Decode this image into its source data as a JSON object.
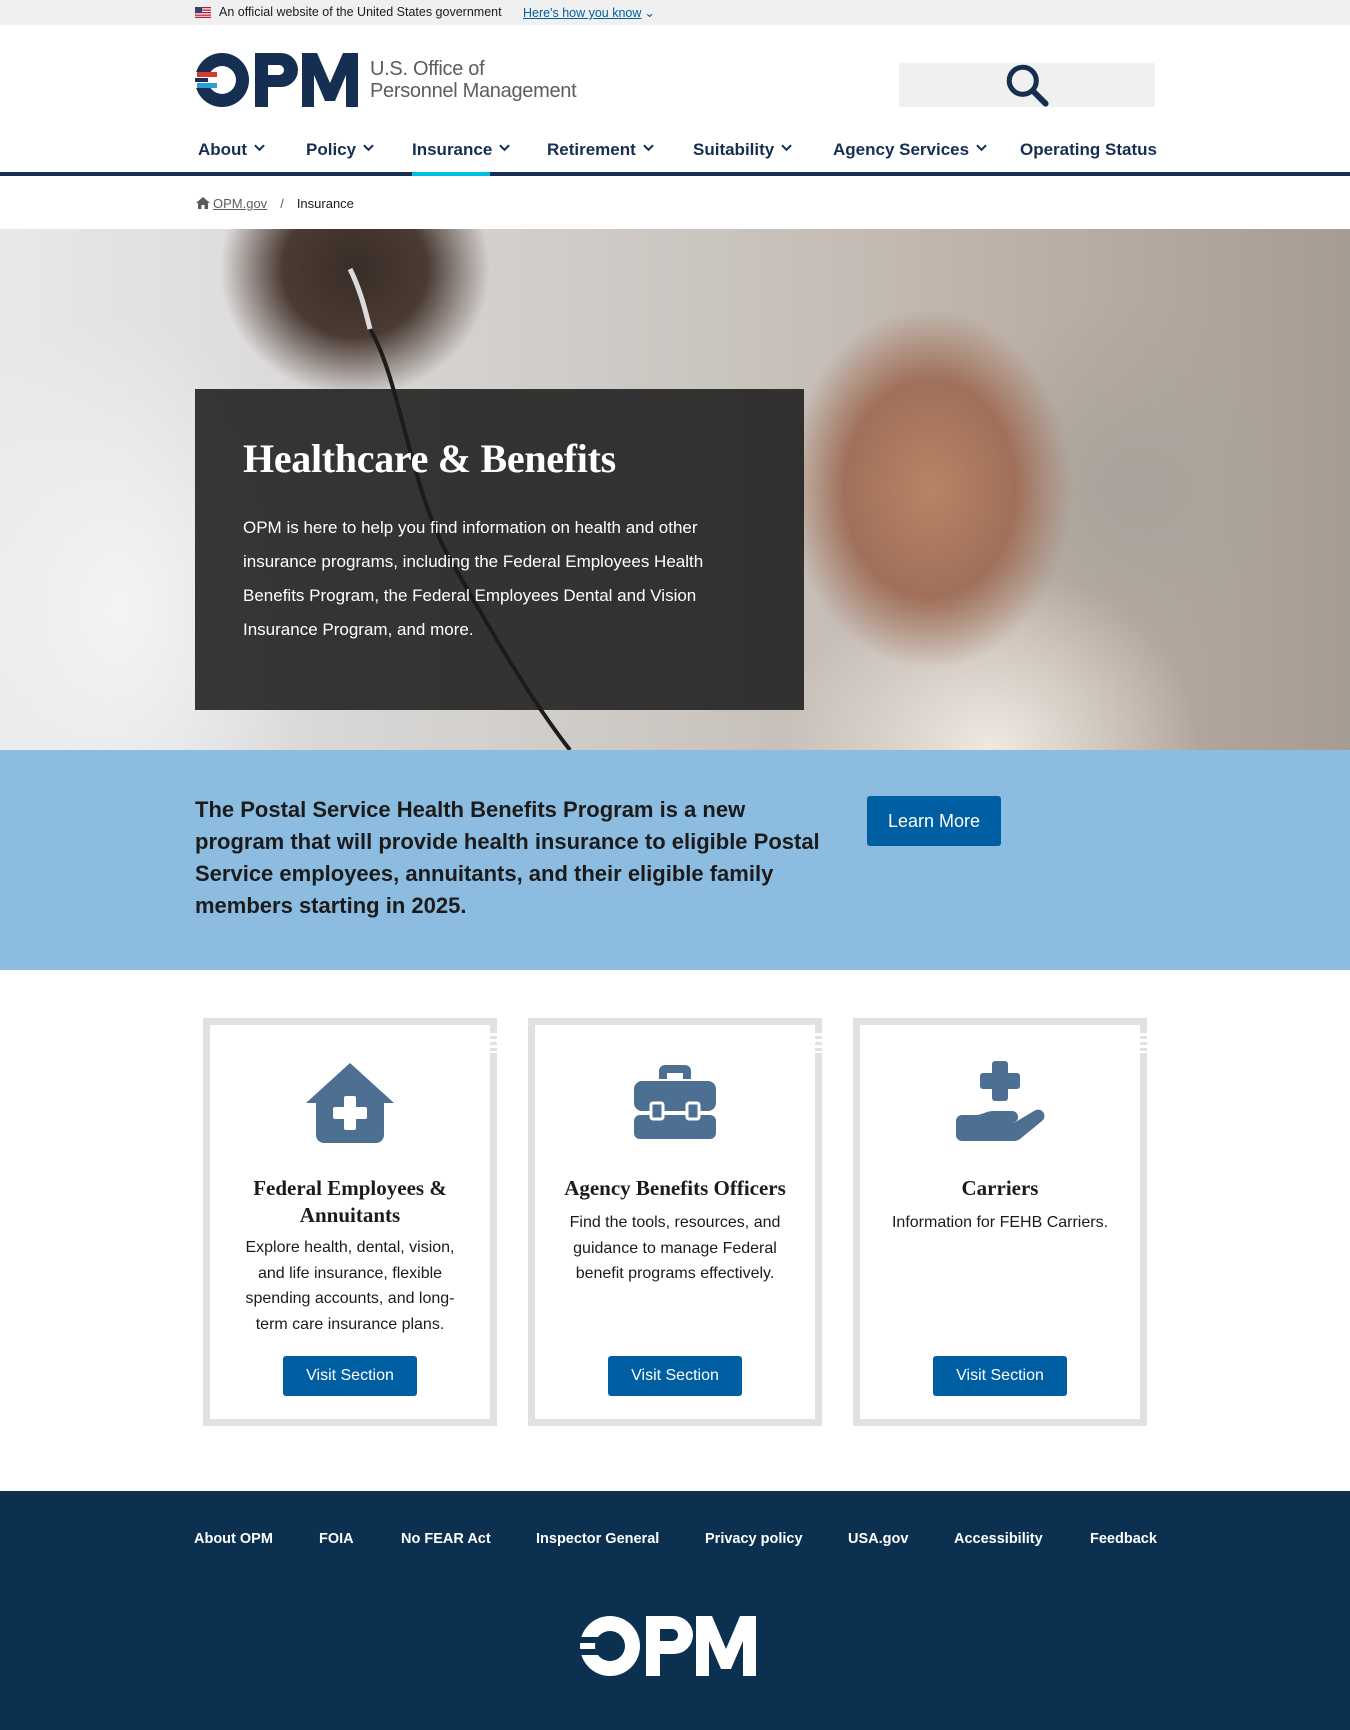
{
  "gov_banner": {
    "official_text": "An official website of the United States government",
    "how_you_know": "Here's how you know"
  },
  "header": {
    "org_line1": "U.S. Office of",
    "org_line2": "Personnel Management",
    "search_placeholder": ""
  },
  "nav": {
    "items": [
      {
        "label": "About"
      },
      {
        "label": "Policy"
      },
      {
        "label": "Insurance"
      },
      {
        "label": "Retirement"
      },
      {
        "label": "Suitability"
      },
      {
        "label": "Agency Services"
      },
      {
        "label": "Operating Status"
      }
    ],
    "active": "Insurance"
  },
  "breadcrumb": {
    "home": "OPM.gov",
    "separator": "/",
    "current": "Insurance"
  },
  "hero": {
    "title": "Healthcare & Benefits",
    "text": "OPM is here to help you find information on health and other insurance programs, including the Federal Employees Health Benefits Program, the Federal Employees Dental and Vision Insurance Program, and more."
  },
  "band": {
    "text": "The Postal Service Health Benefits Program is a new program that will provide health insurance to eligible Postal Service employees, annuitants, and their eligible family members starting in 2025.",
    "button": "Learn More"
  },
  "cards": [
    {
      "icon": "house-medical-icon",
      "title": "Federal Employees & Annuitants",
      "text": "Explore health, dental, vision, and life insurance, flexible spending accounts, and long-term care insurance plans.",
      "button": "Visit Section"
    },
    {
      "icon": "toolbox-icon",
      "title": "Agency Benefits Officers",
      "text": "Find the tools, resources, and guidance to manage Federal benefit programs effectively.",
      "button": "Visit Section"
    },
    {
      "icon": "hand-holding-medical-icon",
      "title": "Carriers",
      "text": "Information for FEHB Carriers.",
      "button": "Visit Section"
    }
  ],
  "footer": {
    "links": [
      "About OPM",
      "FOIA",
      "No FEAR Act",
      "Inspector General",
      "Privacy policy",
      "USA.gov",
      "Accessibility",
      "Feedback"
    ]
  },
  "colors": {
    "primary": "#005ea2",
    "nav_text": "#162e51",
    "active_underline": "#00bde3",
    "band_bg": "#8cbce0",
    "footer_bg": "#0b3050",
    "icon": "#4d6f91"
  }
}
